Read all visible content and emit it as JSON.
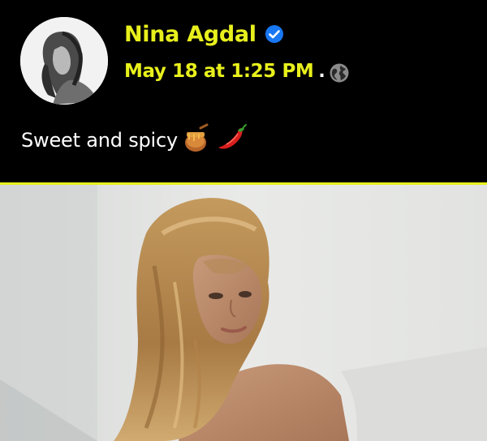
{
  "post": {
    "author_name": "Nina Agdal",
    "verified": true,
    "timestamp": "May 18 at 1:25 PM",
    "separator": ".",
    "audience_icon": "globe-icon",
    "text": "Sweet and spicy",
    "emojis": [
      "honey-pot-emoji",
      "hot-pepper-emoji"
    ]
  },
  "colors": {
    "background": "#000000",
    "accent_yellow": "#e8f01c",
    "verified_blue": "#1877f2",
    "text_white": "#ffffff"
  }
}
